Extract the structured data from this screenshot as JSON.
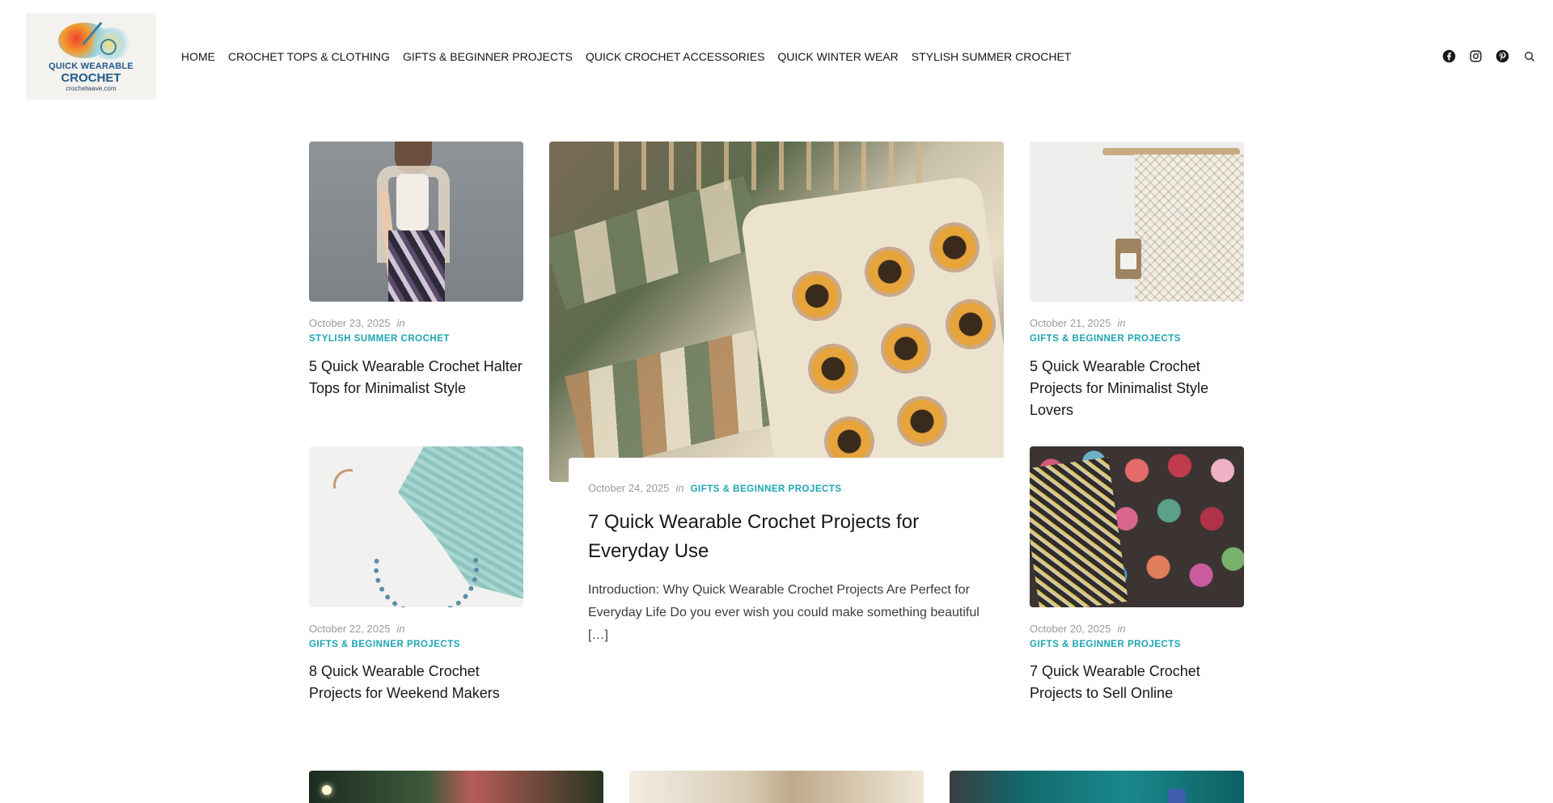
{
  "site": {
    "logo_line1": "QUICK WEARABLE",
    "logo_line2": "CROCHET",
    "logo_url_text": "crochetwave.com"
  },
  "nav": {
    "items": [
      {
        "label": "HOME"
      },
      {
        "label": "CROCHET TOPS & CLOTHING"
      },
      {
        "label": "GIFTS & BEGINNER PROJECTS"
      },
      {
        "label": "QUICK CROCHET ACCESSORIES"
      },
      {
        "label": "QUICK WINTER WEAR"
      },
      {
        "label": "STYLISH SUMMER CROCHET"
      }
    ]
  },
  "social": {
    "icons": [
      "facebook-icon",
      "instagram-icon",
      "pinterest-icon",
      "search-icon"
    ]
  },
  "colors": {
    "accent": "#1ea5b2",
    "text": "#181818",
    "meta": "#9a9a9a"
  },
  "in_label": "in",
  "posts": {
    "p1": {
      "date": "October 23, 2025",
      "category": "STYLISH SUMMER CROCHET",
      "title": "5 Quick Wearable Crochet Halter Tops for Minimalist Style"
    },
    "featured": {
      "date": "October 24, 2025",
      "category": "GIFTS & BEGINNER PROJECTS",
      "title": "7 Quick Wearable Crochet Projects for Everyday Use",
      "excerpt": "Introduction: Why Quick Wearable Crochet Projects Are Perfect for Everyday Life Do you ever wish you could make something beautiful […]"
    },
    "p3": {
      "date": "October 21, 2025",
      "category": "GIFTS & BEGINNER PROJECTS",
      "title": "5 Quick Wearable Crochet Projects for Minimalist Style Lovers"
    },
    "p4": {
      "date": "October 22, 2025",
      "category": "GIFTS & BEGINNER PROJECTS",
      "title": "8 Quick Wearable Crochet Projects for Weekend Makers"
    },
    "p5": {
      "date": "October 20, 2025",
      "category": "GIFTS & BEGINNER PROJECTS",
      "title": "7 Quick Wearable Crochet Projects to Sell Online"
    }
  }
}
